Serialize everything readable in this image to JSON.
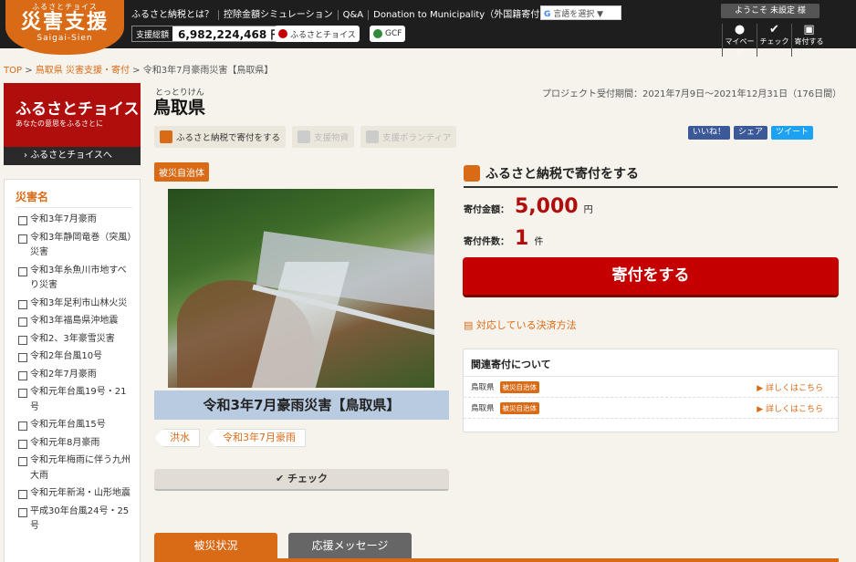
{
  "header": {
    "logo_sub": "ふるさとチョイス",
    "logo_main": "災害支援",
    "logo_romaji": "Saigai-Sien",
    "nav": [
      "ふるさと納税とは？",
      "控除金額シミュレーション",
      "Q&A",
      "Donation to Municipality（外国籍寄付受付）"
    ],
    "translate": "言語を選択",
    "total_label": "支援総額",
    "total_value": "6,982,224,468 円",
    "pill_choice": "ふるさとチョイス",
    "pill_gcf": "GCF",
    "welcome": "ようこそ 未設定 様",
    "icons": [
      {
        "icon": "user-icon",
        "label": "マイページ"
      },
      {
        "icon": "check-icon",
        "label": "チェック"
      },
      {
        "icon": "gift-icon",
        "label": "寄付する"
      }
    ]
  },
  "breadcrumb": {
    "top": "TOP",
    "sep": " > ",
    "section": "鳥取県 災害支援・寄付",
    "current": "令和3年7月豪雨災害【鳥取県】"
  },
  "banner": {
    "title": "ふるさとチョイス",
    "tagline": "あなたの意思をふるさとに",
    "link": "ふるさとチョイスへ"
  },
  "sidebar": {
    "heading": "災害名",
    "items": [
      "令和3年7月豪雨",
      "令和3年静岡竜巻（突風）災害",
      "令和3年糸魚川市地すべり災害",
      "令和3年足利市山林火災",
      "令和3年福島県沖地震",
      "令和2、3年豪雪災害",
      "令和2年台風10号",
      "令和2年7月豪雨",
      "令和元年台風19号・21号",
      "令和元年台風15号",
      "令和元年8月豪雨",
      "令和元年梅雨に伴う九州大雨",
      "令和元年新潟・山形地震",
      "平成30年台風24号・25号"
    ]
  },
  "main": {
    "ruby": "とっとりけん",
    "title": "鳥取県",
    "period": "プロジェクト受付期間：2021年7月9日〜2021年12月31日（176日間）",
    "tabs": [
      "ふるさと納税で寄付をする",
      "支援物資",
      "支援ボランティア"
    ],
    "social": [
      "いいね！",
      "シェア",
      "ツイート"
    ],
    "badge": "被災自治体",
    "caption": "令和3年7月豪雨災害【鳥取県】",
    "tags": [
      "洪水",
      "令和3年7月豪雨"
    ],
    "check": "✔ チェック",
    "bottom_tabs": [
      "被災状況",
      "応援メッセージ"
    ]
  },
  "right": {
    "heading": "ふるさと納税で寄付をする",
    "amount_label": "寄付金額：",
    "amount_value": "5,000",
    "amount_unit": "円",
    "count_label": "寄付件数：",
    "count_value": "1",
    "count_unit": "件",
    "donate": "寄付をする",
    "payment_link": "対応している決済方法",
    "related_heading": "関連寄付について",
    "related": [
      {
        "name": "鳥取県",
        "badge": "被災自治体",
        "link": "▶ 詳しくはこちら"
      },
      {
        "name": "鳥取県",
        "badge": "被災自治体",
        "link": "▶ 詳しくはこちら"
      }
    ]
  },
  "colors": {
    "accent": "#d96b17",
    "brand_red": "#b00d0d",
    "donate": "#c40000"
  }
}
